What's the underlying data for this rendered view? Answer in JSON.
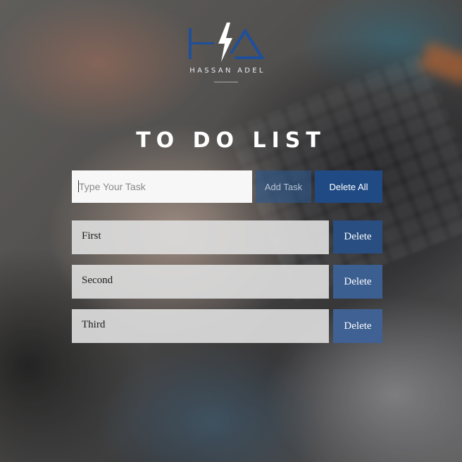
{
  "logo": {
    "brand_text": "HASSAN ADEL",
    "monogram": "HA",
    "icon": "lightning-bolt-icon",
    "color": "#1f4f9a"
  },
  "title": "TO DO LIST",
  "input": {
    "value": "",
    "placeholder": "Type Your Task"
  },
  "buttons": {
    "add_label": "Add Task",
    "delete_all_label": "Delete All"
  },
  "tasks": [
    {
      "text": "First",
      "delete_label": "Delete"
    },
    {
      "text": "Second",
      "delete_label": "Delete"
    },
    {
      "text": "Third",
      "delete_label": "Delete"
    }
  ],
  "colors": {
    "button_primary": "#1f4a84",
    "button_secondary": "#3c5f91",
    "task_background": "#dcdcdc"
  }
}
